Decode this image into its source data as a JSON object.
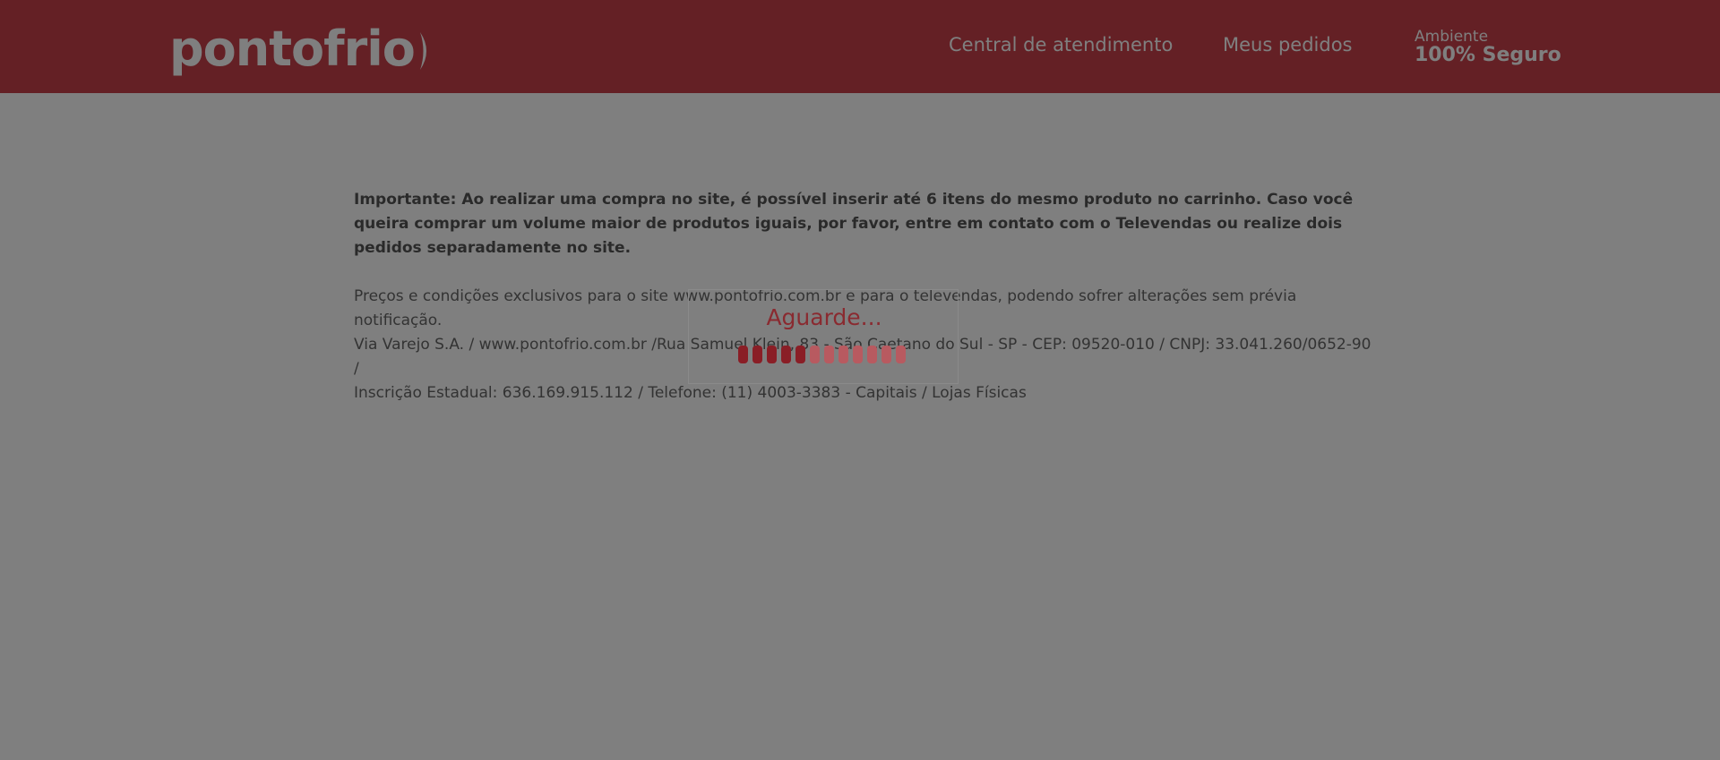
{
  "header": {
    "logo_text": "pontofrio",
    "nav": {
      "central": "Central de atendimento",
      "pedidos": "Meus pedidos"
    },
    "secure": {
      "small": "Ambiente",
      "big": "100% Seguro"
    }
  },
  "main": {
    "important": "Importante: Ao realizar uma compra no site, é possível inserir até 6 itens do mesmo produto no carrinho. Caso você queira comprar um volume maior de produtos iguais, por favor, entre em contato com o Televendas ou realize dois pedidos separadamente no site.",
    "info_lines": [
      "Preços e condições exclusivos para o site www.pontofrio.com.br e para o televendas, podendo sofrer alterações sem prévia notificação.",
      "Via Varejo S.A. / www.pontofrio.com.br /Rua Samuel Klein, 83 - São Caetano do Sul - SP - CEP: 09520-010 / CNPJ: 33.041.260/0652-90 /",
      "Inscrição Estadual: 636.169.915.112 / Telefone: (11) 4003-3383 - Capitais / Lojas Físicas"
    ]
  },
  "loading": {
    "text": "Aguarde...",
    "progress": 0.42
  },
  "colors": {
    "brand": "#c8404a",
    "overlay": "rgba(0,0,0,0.5)",
    "loader_active": "#8a1e26",
    "loader_inactive": "#b85a60"
  }
}
